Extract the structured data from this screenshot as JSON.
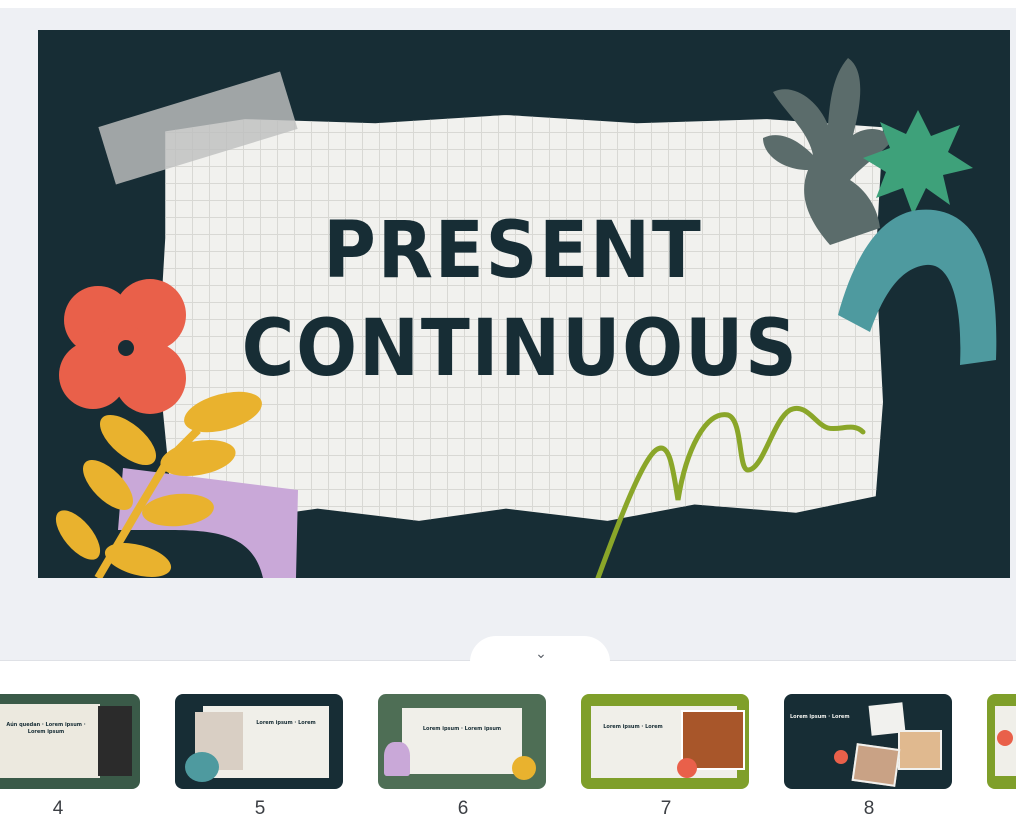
{
  "slide": {
    "title_line1": "PRESENT",
    "title_line2": "CONTINUOUS",
    "colors": {
      "background": "#172d35",
      "paper": "#f1f1ee",
      "red": "#e9604a",
      "yellow": "#e9b22e",
      "lilac": "#c9a8d8",
      "teal": "#4e9a9f",
      "green": "#3ea17a",
      "olive": "#8aa629"
    }
  },
  "collapse": {
    "icon": "chevron-down-icon",
    "glyph": "⌄"
  },
  "thumbnails": [
    {
      "number": "4",
      "bg": "#3a5a48"
    },
    {
      "number": "5",
      "bg": "#172d35"
    },
    {
      "number": "6",
      "bg": "#4e6e55"
    },
    {
      "number": "7",
      "bg": "#7f9f2a"
    },
    {
      "number": "8",
      "bg": "#172d35"
    },
    {
      "number": "",
      "bg": "#7f9f2a"
    }
  ]
}
